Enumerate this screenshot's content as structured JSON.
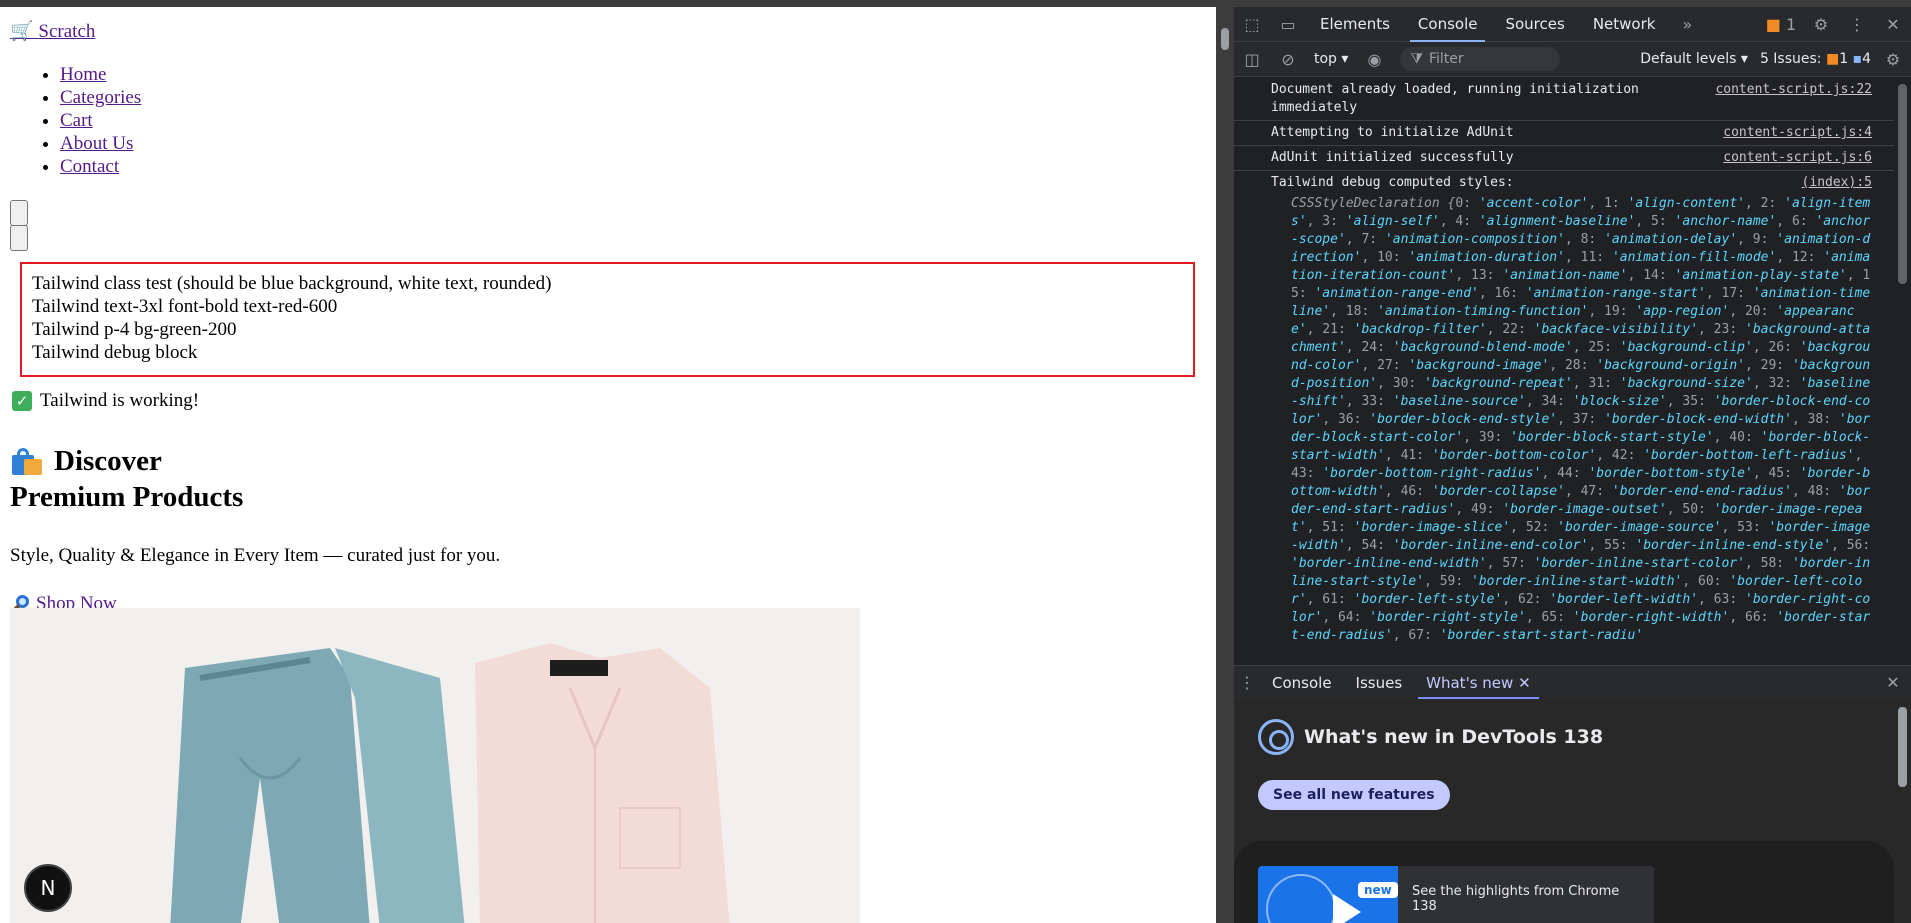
{
  "page": {
    "brand": "Scratch",
    "nav": [
      "Home",
      "Categories",
      "Cart",
      "About Us",
      "Contact"
    ],
    "debug_lines": [
      "Tailwind class test (should be blue background, white text, rounded)",
      "Tailwind text-3xl font-bold text-red-600",
      "Tailwind p-4 bg-green-200",
      "Tailwind debug block"
    ],
    "working": "Tailwind is working!",
    "hero_line1": "Discover",
    "hero_line2": "Premium Products",
    "tagline": "Style, Quality & Elegance in Every Item — curated just for you.",
    "shop_now": "Shop Now",
    "next_badge": "N"
  },
  "devtools": {
    "tabs": [
      "Elements",
      "Console",
      "Sources",
      "Network"
    ],
    "active_tab": "Console",
    "warn_count": "1",
    "context": "top",
    "filter_placeholder": "Filter",
    "levels": "Default levels",
    "issues_label": "5 Issues:",
    "issues_warn": "1",
    "issues_info": "4",
    "messages": [
      {
        "text": "Document already loaded, running initialization immediately",
        "source": "content-script.js:22"
      },
      {
        "text": "Attempting to initialize AdUnit",
        "source": "content-script.js:4"
      },
      {
        "text": "AdUnit initialized successfully",
        "source": "content-script.js:6"
      },
      {
        "text": "Tailwind debug computed styles:",
        "source": "(index):5"
      }
    ],
    "css_class": "CSSStyleDeclaration",
    "css_props": [
      "accent-color",
      "align-content",
      "align-items",
      "align-self",
      "alignment-baseline",
      "anchor-name",
      "anchor-scope",
      "animation-composition",
      "animation-delay",
      "animation-direction",
      "animation-duration",
      "animation-fill-mode",
      "animation-iteration-count",
      "animation-name",
      "animation-play-state",
      "animation-range-end",
      "animation-range-start",
      "animation-timeline",
      "animation-timing-function",
      "app-region",
      "appearance",
      "backdrop-filter",
      "backface-visibility",
      "background-attachment",
      "background-blend-mode",
      "background-clip",
      "background-color",
      "background-image",
      "background-origin",
      "background-position",
      "background-repeat",
      "background-size",
      "baseline-shift",
      "baseline-source",
      "block-size",
      "border-block-end-color",
      "border-block-end-style",
      "border-block-end-width",
      "border-block-start-color",
      "border-block-start-style",
      "border-block-start-width",
      "border-bottom-color",
      "border-bottom-left-radius",
      "border-bottom-right-radius",
      "border-bottom-style",
      "border-bottom-width",
      "border-collapse",
      "border-end-end-radius",
      "border-end-start-radius",
      "border-image-outset",
      "border-image-repeat",
      "border-image-slice",
      "border-image-source",
      "border-image-width",
      "border-inline-end-color",
      "border-inline-end-style",
      "border-inline-end-width",
      "border-inline-start-color",
      "border-inline-start-style",
      "border-inline-start-width",
      "border-left-color",
      "border-left-style",
      "border-left-width",
      "border-right-color",
      "border-right-style",
      "border-right-width",
      "border-start-end-radius",
      "border-start-start-radiu"
    ],
    "drawer_tabs": [
      "Console",
      "Issues",
      "What's new"
    ],
    "whats_new_title": "What's new in DevTools 138",
    "see_all": "See all new features",
    "highlight_text": "See the highlights from Chrome 138",
    "new_badge": "new"
  },
  "colors": {
    "accent": "#8ab4f8",
    "debug_border": "#e01b24",
    "link": "#551a8b",
    "warn": "#f28b26"
  }
}
